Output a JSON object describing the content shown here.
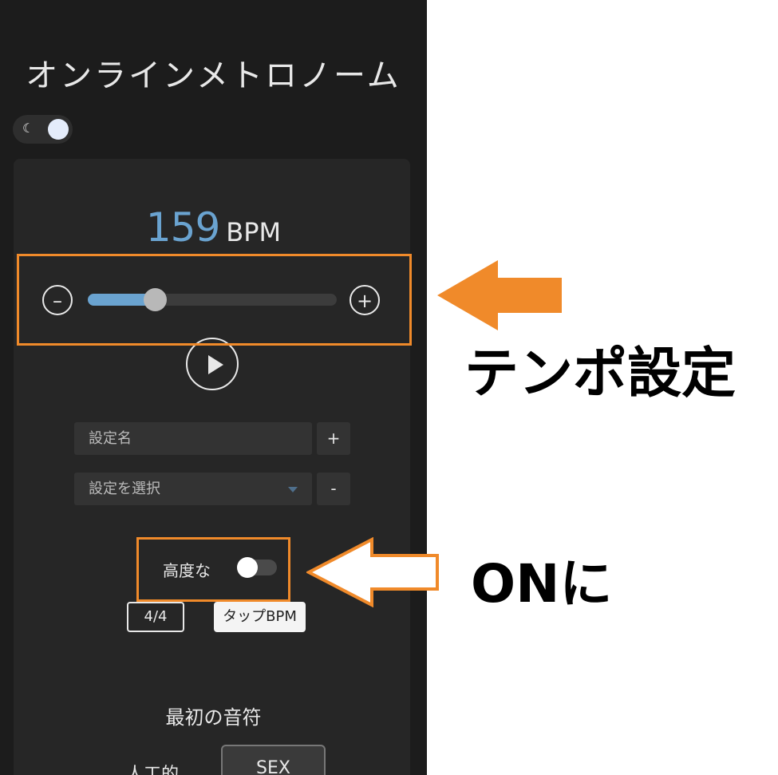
{
  "app": {
    "title": "オンラインメトロノーム",
    "theme_toggle": {
      "icon": "moon-icon",
      "state": "dark"
    }
  },
  "tempo": {
    "value": "159",
    "unit": "BPM",
    "slider_fraction": 0.27,
    "decrease_label": "–",
    "increase_label": "+"
  },
  "play": {
    "icon": "play-icon"
  },
  "preset": {
    "name_placeholder": "設定名",
    "add_label": "+",
    "select_placeholder": "設定を選択",
    "remove_label": "-"
  },
  "advanced": {
    "label": "高度な",
    "toggle_on": false
  },
  "buttons": {
    "time_signature": "4/4",
    "tap_bpm": "タップBPM"
  },
  "first_note": {
    "heading": "最初の音符",
    "option_label": "人工的",
    "option_button": "SEX"
  },
  "annotations": {
    "tempo_label": "テンポ設定",
    "on_label": "ONに",
    "colors": {
      "highlight": "#f08a2a",
      "accent": "#6aa3d0"
    }
  }
}
